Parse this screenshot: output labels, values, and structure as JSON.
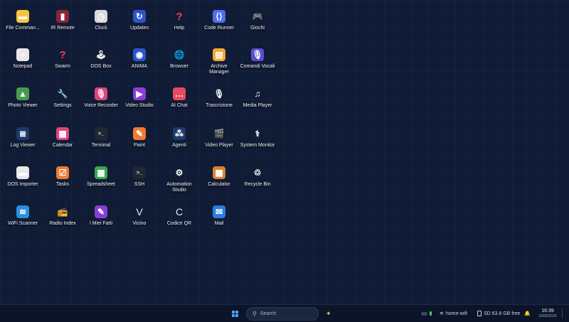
{
  "desktop": {
    "apps": [
      {
        "label": "File Comman...",
        "icon": "folder-icon",
        "color": "#f5c542",
        "glyph": "▬"
      },
      {
        "label": "IR Remote",
        "icon": "remote-icon",
        "color": "#8a2535",
        "glyph": "▮"
      },
      {
        "label": "Clock",
        "icon": "clock-icon",
        "color": "#d9d9d9",
        "glyph": "◷"
      },
      {
        "label": "Updates",
        "icon": "refresh-icon",
        "color": "#2d55c9",
        "glyph": "↻"
      },
      {
        "label": "Help",
        "icon": "question-icon",
        "color": "transparent",
        "glyph": "?"
      },
      {
        "label": "Code Runner",
        "icon": "code-icon",
        "color": "#4f6ef0",
        "glyph": "⟨⟩"
      },
      {
        "label": "Giochi",
        "icon": "gamepad-icon",
        "color": "transparent",
        "glyph": "🎮"
      },
      {
        "label": "Notepad",
        "icon": "notepad-icon",
        "color": "#e8e8e8",
        "glyph": "≡"
      },
      {
        "label": "Swarm",
        "icon": "question-icon",
        "color": "transparent",
        "glyph": "?"
      },
      {
        "label": "DOS Box",
        "icon": "joystick-icon",
        "color": "transparent",
        "glyph": "🕹"
      },
      {
        "label": "ANIMA",
        "icon": "anima-icon",
        "color": "#2d55c9",
        "glyph": "◉"
      },
      {
        "label": "Browser",
        "icon": "globe-icon",
        "color": "transparent",
        "glyph": "🌐"
      },
      {
        "label": "Archive Manager",
        "icon": "archive-icon",
        "color": "#f0a832",
        "glyph": "▤"
      },
      {
        "label": "Comandi Vocali",
        "icon": "microphone-icon",
        "color": "#5a4ed1",
        "glyph": "🎙"
      },
      {
        "label": "Photo Viewer",
        "icon": "image-icon",
        "color": "#4a9a4e",
        "glyph": "▲"
      },
      {
        "label": "Settings",
        "icon": "wrench-icon",
        "color": "transparent",
        "glyph": "🔧"
      },
      {
        "label": "Voice Recorder",
        "icon": "microphone-icon",
        "color": "#e0457b",
        "glyph": "🎙"
      },
      {
        "label": "Video Studio",
        "icon": "video-icon",
        "color": "#8a3ed6",
        "glyph": "▶"
      },
      {
        "label": "AI Chat",
        "icon": "chat-icon",
        "color": "#e84a5f",
        "glyph": "…"
      },
      {
        "label": "Trascrizione",
        "icon": "transcribe-icon",
        "color": "transparent",
        "glyph": "🎙"
      },
      {
        "label": "Media Player",
        "icon": "music-icon",
        "color": "transparent",
        "glyph": "♫"
      },
      {
        "label": "Log Viewer",
        "icon": "log-icon",
        "color": "#1d3a6a",
        "glyph": "≣"
      },
      {
        "label": "Calendar",
        "icon": "calendar-icon",
        "color": "#e0457b",
        "glyph": "▦"
      },
      {
        "label": "Terminal",
        "icon": "terminal-icon",
        "color": "#1f2733",
        "glyph": ">_"
      },
      {
        "label": "Paint",
        "icon": "paint-icon",
        "color": "#f07a32",
        "glyph": "✎"
      },
      {
        "label": "Agenti",
        "icon": "agents-icon",
        "color": "#1d3a6a",
        "glyph": "⁂"
      },
      {
        "label": "Video Player",
        "icon": "clapper-icon",
        "color": "transparent",
        "glyph": "🎬"
      },
      {
        "label": "System Monitor",
        "icon": "stethoscope-icon",
        "color": "transparent",
        "glyph": "⚕"
      },
      {
        "label": "DOS Importer",
        "icon": "floppy-icon",
        "color": "#e8e8e8",
        "glyph": "▬"
      },
      {
        "label": "Tasks",
        "icon": "tasks-icon",
        "color": "#f07a32",
        "glyph": "☑"
      },
      {
        "label": "Spreadsheet",
        "icon": "spreadsheet-icon",
        "color": "#3aa657",
        "glyph": "▦"
      },
      {
        "label": "SSH",
        "icon": "ssh-icon",
        "color": "#1f2733",
        "glyph": ">_"
      },
      {
        "label": "Automation Studio",
        "icon": "gear-icon",
        "color": "transparent",
        "glyph": "⚙"
      },
      {
        "label": "Calculator",
        "icon": "abacus-icon",
        "color": "#d4862e",
        "glyph": "▦"
      },
      {
        "label": "Recycle Bin",
        "icon": "recycle-icon",
        "color": "transparent",
        "glyph": "♲"
      },
      {
        "label": "WiFi Scanner",
        "icon": "wifi-icon",
        "color": "#2b8fe0",
        "glyph": "≋"
      },
      {
        "label": "Radio Index",
        "icon": "radio-icon",
        "color": "transparent",
        "glyph": "📻"
      },
      {
        "label": "I Miei Fatti",
        "icon": "note-icon",
        "color": "#8a3ed6",
        "glyph": "✎"
      },
      {
        "label": "Vicino",
        "icon": "vicino-icon",
        "color": "transparent",
        "glyph": "V"
      },
      {
        "label": "Codice QR",
        "icon": "qr-icon",
        "color": "transparent",
        "glyph": "C"
      },
      {
        "label": "Mail",
        "icon": "mail-icon",
        "color": "#2b7de0",
        "glyph": "✉"
      }
    ]
  },
  "taskbar": {
    "start_icon": "windows-logo-icon",
    "search_placeholder": "Search",
    "copilot_icon": "sparkle-icon",
    "wifi_name": "home-wifi",
    "storage": "SD 63.8 GB free",
    "time": "16:39",
    "date": "29/08/2026",
    "accent": "#4aa3ff"
  }
}
